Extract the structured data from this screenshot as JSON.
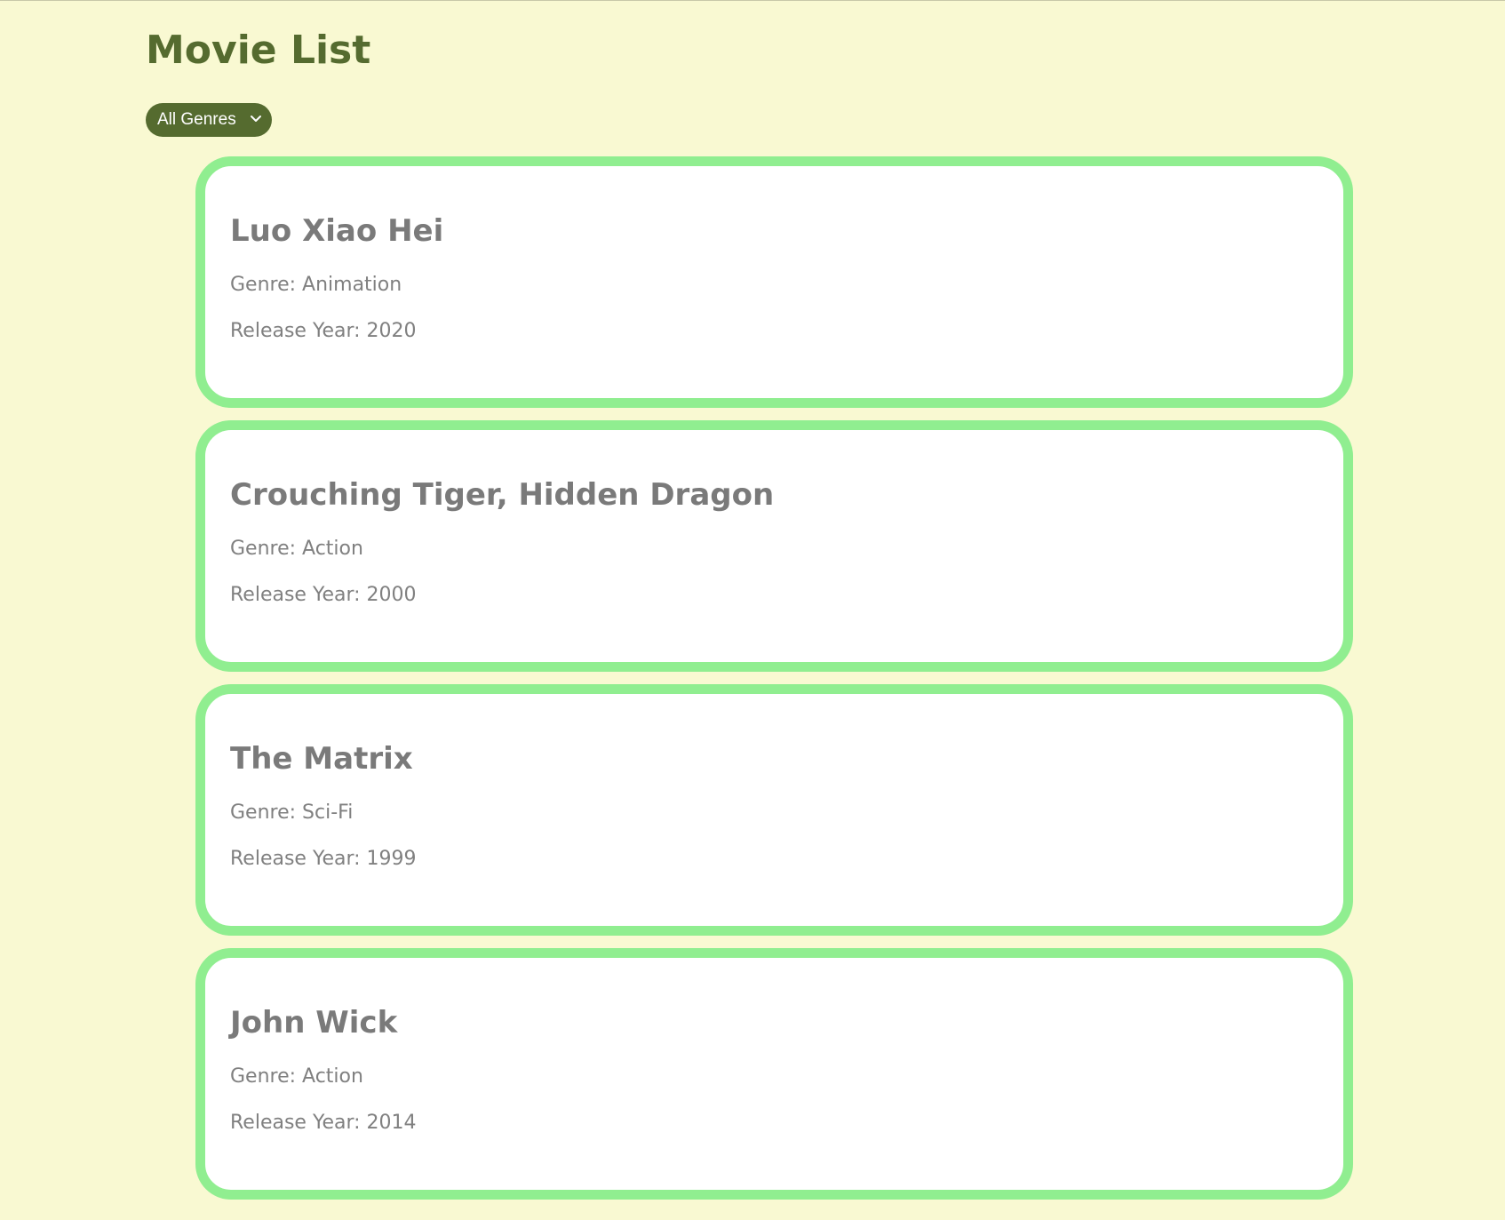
{
  "page": {
    "title": "Movie List"
  },
  "filter": {
    "selected": "All Genres",
    "icon": "chevron-down-icon"
  },
  "movies": [
    {
      "title": "Luo Xiao Hei",
      "genre_line": "Genre: Animation",
      "year_line": "Release Year: 2020"
    },
    {
      "title": "Crouching Tiger, Hidden Dragon",
      "genre_line": "Genre: Action",
      "year_line": "Release Year: 2000"
    },
    {
      "title": "The Matrix",
      "genre_line": "Genre: Sci-Fi",
      "year_line": "Release Year: 1999"
    },
    {
      "title": "John Wick",
      "genre_line": "Genre: Action",
      "year_line": "Release Year: 2014"
    }
  ],
  "colors": {
    "background": "#f9f9d2",
    "accent": "#556b2f",
    "card_border": "#90ee90",
    "card_text": "#808080"
  }
}
